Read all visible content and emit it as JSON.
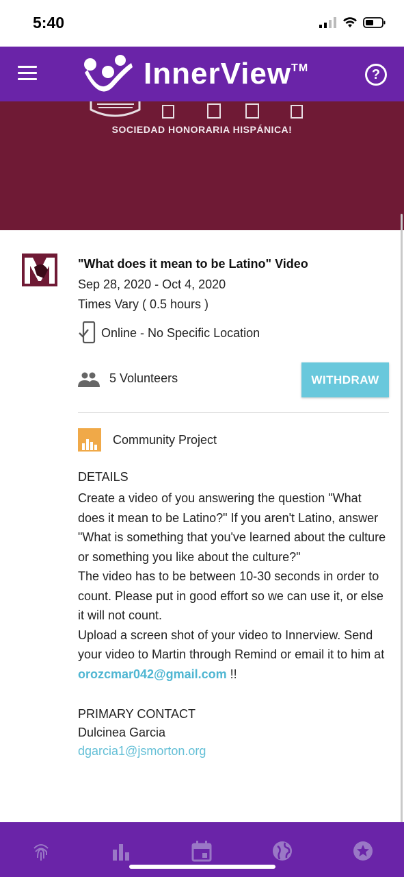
{
  "status_bar": {
    "time": "5:40"
  },
  "header": {
    "brand": "InnerView",
    "trademark": "TM"
  },
  "banner": {
    "text": "SOCIEDAD HONORARIA HISPÁNICA!"
  },
  "event": {
    "title": "\"What does it mean to be Latino\" Video",
    "dates": "Sep 28, 2020 - Oct 4, 2020",
    "times": "Times Vary ( 0.5 hours )",
    "location": "Online - No Specific Location",
    "volunteers": "5 Volunteers",
    "withdraw_label": "WITHDRAW",
    "category": "Community Project"
  },
  "details": {
    "heading": "DETAILS",
    "paragraph1": "Create a video of you answering the question \"What does it mean to be Latino?\" If you aren't Latino, answer \"What is something that you've learned about the culture or something you like about the culture?\"",
    "paragraph2": "The video has to be between 10-30 seconds in order to count. Please put in good effort so we can use it, or else it will not count.",
    "paragraph3_prefix": "Upload a screen shot of your video to Innerview. Send your video to Martin through Remind or email it to him at ",
    "paragraph3_email": "orozcmar042@gmail.com",
    "paragraph3_suffix": " !!"
  },
  "contact": {
    "heading": "PRIMARY CONTACT",
    "name": "Dulcinea Garcia",
    "email": "dgarcia1@jsmorton.org"
  },
  "colors": {
    "header": "#6a24a8",
    "banner": "#6f1a35",
    "accent": "#69c8dc",
    "category": "#f0a948"
  },
  "bottom_nav": {
    "items": [
      "fingerprint-icon",
      "bar-chart-icon",
      "calendar-icon",
      "globe-icon",
      "star-badge-icon"
    ]
  }
}
